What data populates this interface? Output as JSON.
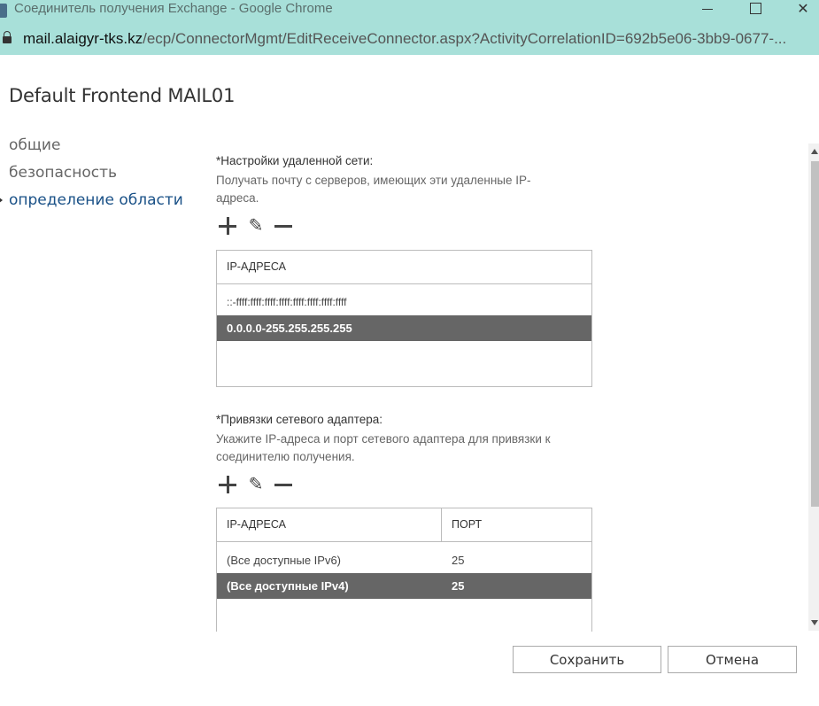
{
  "window": {
    "title": "Соединитель получения Exchange - Google Chrome",
    "min_icon": "minimize-icon",
    "max_icon": "maximize-icon",
    "close_glyph": "✕"
  },
  "address": {
    "host": "mail.alaigyr-tks.kz",
    "path": "/ecp/ConnectorMgmt/EditReceiveConnector.aspx?ActivityCorrelationID=692b5e06-3bb9-0677-..."
  },
  "page": {
    "title": "Default Frontend MAIL01"
  },
  "nav": {
    "items": [
      {
        "label": "общие"
      },
      {
        "label": "безопасность"
      },
      {
        "label": "определение области"
      }
    ]
  },
  "remote_network": {
    "label": "*Настройки удаленной сети:",
    "description": "Получать почту с серверов, имеющих эти удаленные IP-адреса.",
    "toolbar": {
      "edit_glyph": "✎"
    },
    "column_header": "IP-АДРЕСА",
    "rows": [
      {
        "ip": "::-ffff:ffff:ffff:ffff:ffff:ffff:ffff:ffff",
        "selected": false
      },
      {
        "ip": "0.0.0.0-255.255.255.255",
        "selected": true
      }
    ]
  },
  "bindings": {
    "label": "*Привязки сетевого адаптера:",
    "description": "Укажите IP-адреса и порт сетевого адаптера для привязки к соединителю получения.",
    "toolbar": {
      "edit_glyph": "✎"
    },
    "col_ip": "IP-АДРЕСА",
    "col_port": "ПОРТ",
    "rows": [
      {
        "ip": "(Все доступные IPv6)",
        "port": "25",
        "selected": false
      },
      {
        "ip": "(Все доступные IPv4)",
        "port": "25",
        "selected": true
      }
    ]
  },
  "buttons": {
    "save": "Сохранить",
    "cancel": "Отмена"
  }
}
